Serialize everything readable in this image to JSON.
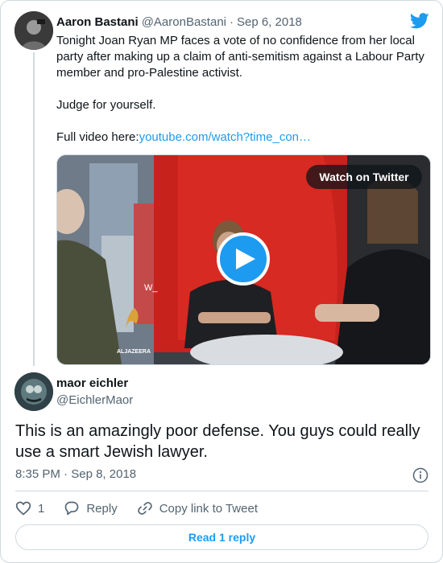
{
  "tweet": {
    "author_name": "Aaron Bastani",
    "handle": "@AaronBastani",
    "separator": "·",
    "date": "Sep 6, 2018",
    "text_line1": "Tonight Joan Ryan MP faces a vote of no confidence from her local party after making up a claim of anti-semitism against a Labour Party member and pro-Palestine activist.",
    "text_line2": "Judge for yourself.",
    "text_line3_prefix": "Full video here:",
    "text_line3_link": "youtube.com/watch?time_con…",
    "media": {
      "watch_label": "Watch on Twitter",
      "channel_logo_text": "ALJAZEERA",
      "overlay_text": "W_"
    },
    "brand_icon": "twitter-bird-icon"
  },
  "reply": {
    "author_name": "maor eichler",
    "handle": "@EichlerMaor",
    "text": "This is an amazingly poor defense. You guys could really use a smart Jewish lawyer.",
    "time": "8:35 PM",
    "separator": "·",
    "date": "Sep 8, 2018",
    "like_count": "1",
    "reply_label": "Reply",
    "copy_link_label": "Copy link to Tweet",
    "read_replies_label": "Read 1 reply"
  },
  "colors": {
    "accent": "#1d9bf0",
    "text": "#0f1419",
    "muted": "#536471",
    "border": "#cfd9de"
  }
}
